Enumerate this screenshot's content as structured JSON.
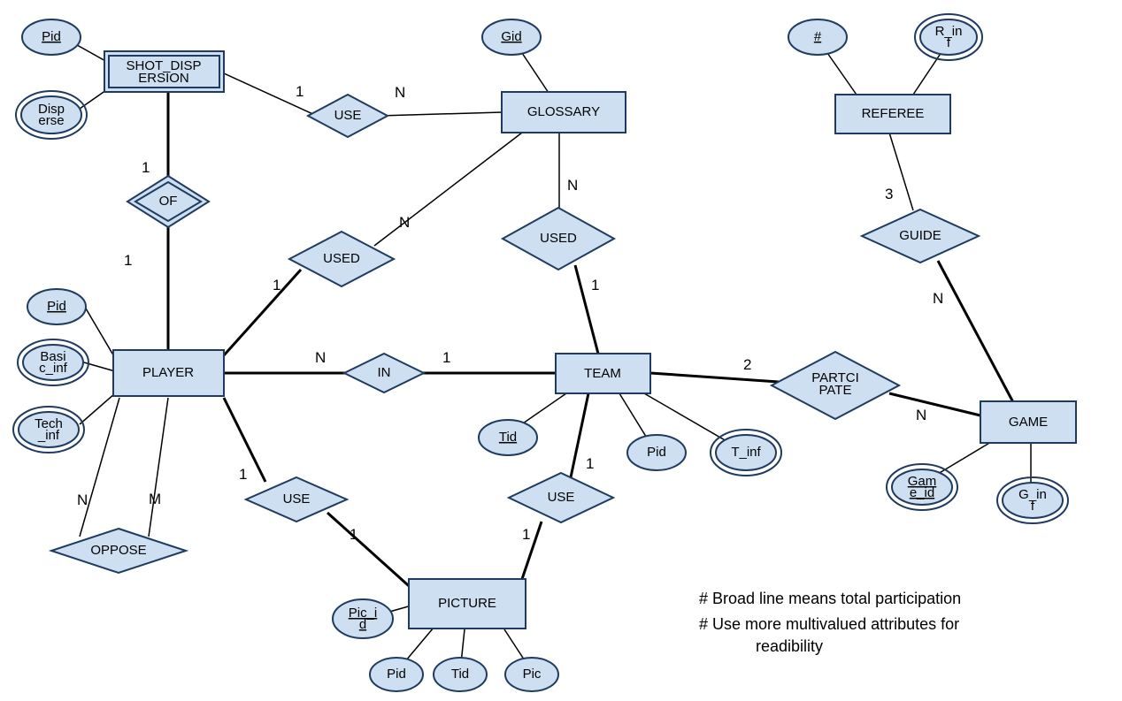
{
  "entities": {
    "shot_dispersion": "SHOT_DISPERSION",
    "glossary": "GLOSSARY",
    "referee": "REFEREE",
    "player": "PLAYER",
    "team": "TEAM",
    "game": "GAME",
    "picture": "PICTURE"
  },
  "relationships": {
    "use1": "USE",
    "of": "OF",
    "used1": "USED",
    "used2": "USED",
    "guide": "GUIDE",
    "in": "IN",
    "participate": "PARTCIPATE",
    "oppose": "OPPOSE",
    "use_player_pic": "USE",
    "use_team_pic": "USE"
  },
  "attributes": {
    "sd_pid": "Pid",
    "disperse": "Disperse",
    "gid": "Gid",
    "ref_num": "#",
    "r_inf": "R_inf",
    "player_pid": "Pid",
    "basic_inf": "Basic_inf",
    "tech_inf": "Tech_inf",
    "team_tid": "Tid",
    "team_pid": "Pid",
    "t_inf": "T_inf",
    "game_id": "Game_id",
    "g_inf": "G_inf",
    "pic_id": "Pic_id",
    "pic_pid": "Pid",
    "pic_tid": "Tid",
    "pic": "Pic"
  },
  "cards": {
    "sd_use": "1",
    "gloss_use": "N",
    "sd_of": "1",
    "player_of": "1",
    "player_used1": "1",
    "gloss_used1": "N",
    "team_used2": "1",
    "gloss_used2": "N",
    "player_in": "N",
    "team_in": "1",
    "team_part": "2",
    "game_part": "N",
    "ref_guide": "3",
    "game_guide": "N",
    "oppose_n": "N",
    "oppose_m": "M",
    "player_usepic": "1",
    "pic_useplayer": "1",
    "team_usepic": "1",
    "pic_useteam": "1"
  },
  "notes": {
    "n1": "# Broad line means  total participation",
    "n2": "# Use more multivalued attributes for",
    "n2b": "readibility"
  }
}
